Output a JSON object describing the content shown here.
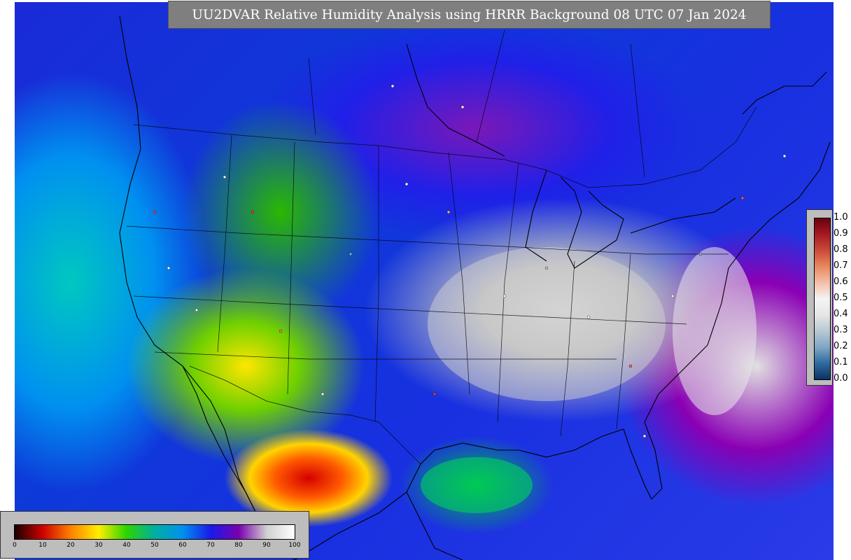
{
  "title": "UU2DVAR Relative Humidity Analysis using HRRR Background 08 UTC 07 Jan 2024",
  "rh_colorbar": {
    "ticks": [
      "0",
      "10",
      "20",
      "30",
      "40",
      "50",
      "60",
      "70",
      "80",
      "90",
      "100"
    ],
    "colors": [
      "#1a0000",
      "#cc0000",
      "#ff8000",
      "#ffee00",
      "#2ad400",
      "#00b0a0",
      "#0090f0",
      "#1a1ae8",
      "#7a00b0",
      "#d0d0d0",
      "#ffffff"
    ]
  },
  "fraction_colorbar": {
    "ticks": [
      "0.0",
      "0.1",
      "0.2",
      "0.3",
      "0.4",
      "0.5",
      "0.6",
      "0.7",
      "0.8",
      "0.9",
      "1.0"
    ],
    "colors": [
      "#0b3260",
      "#2e6aa0",
      "#7fa6c4",
      "#b8c8d4",
      "#e6e6e6",
      "#f4f4f4",
      "#f4c0a8",
      "#e8895e",
      "#cc4a3a",
      "#a51a24",
      "#6a0010"
    ]
  }
}
